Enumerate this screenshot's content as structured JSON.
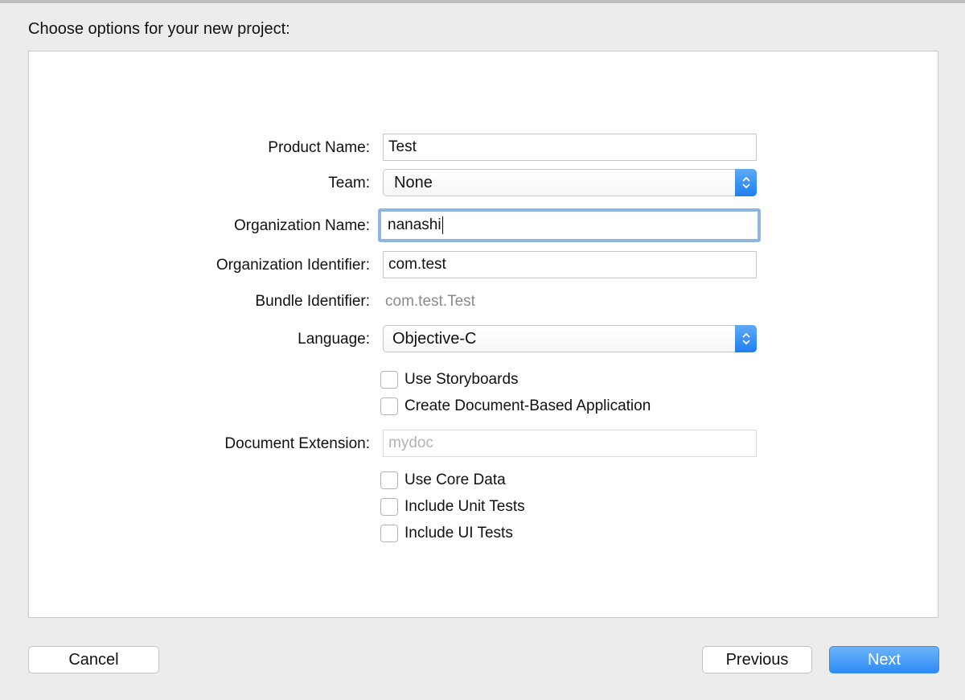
{
  "dialog": {
    "title": "Choose options for your new project:"
  },
  "form": {
    "product_name": {
      "label": "Product Name:",
      "value": "Test"
    },
    "team": {
      "label": "Team:",
      "value": "None"
    },
    "organization_name": {
      "label": "Organization Name:",
      "value": "nanashi"
    },
    "organization_identifier": {
      "label": "Organization Identifier:",
      "value": "com.test"
    },
    "bundle_identifier": {
      "label": "Bundle Identifier:",
      "value": "com.test.Test"
    },
    "language": {
      "label": "Language:",
      "value": "Objective-C"
    },
    "use_storyboards": {
      "label": "Use Storyboards",
      "checked": false
    },
    "create_document_based": {
      "label": "Create Document-Based Application",
      "checked": false
    },
    "document_extension": {
      "label": "Document Extension:",
      "placeholder": "mydoc"
    },
    "use_core_data": {
      "label": "Use Core Data",
      "checked": false
    },
    "include_unit_tests": {
      "label": "Include Unit Tests",
      "checked": false
    },
    "include_ui_tests": {
      "label": "Include UI Tests",
      "checked": false
    }
  },
  "buttons": {
    "cancel": "Cancel",
    "previous": "Previous",
    "next": "Next"
  },
  "colors": {
    "accent": "#2d8bf6",
    "focus_ring": "#8fb5e3",
    "background": "#ececec"
  }
}
